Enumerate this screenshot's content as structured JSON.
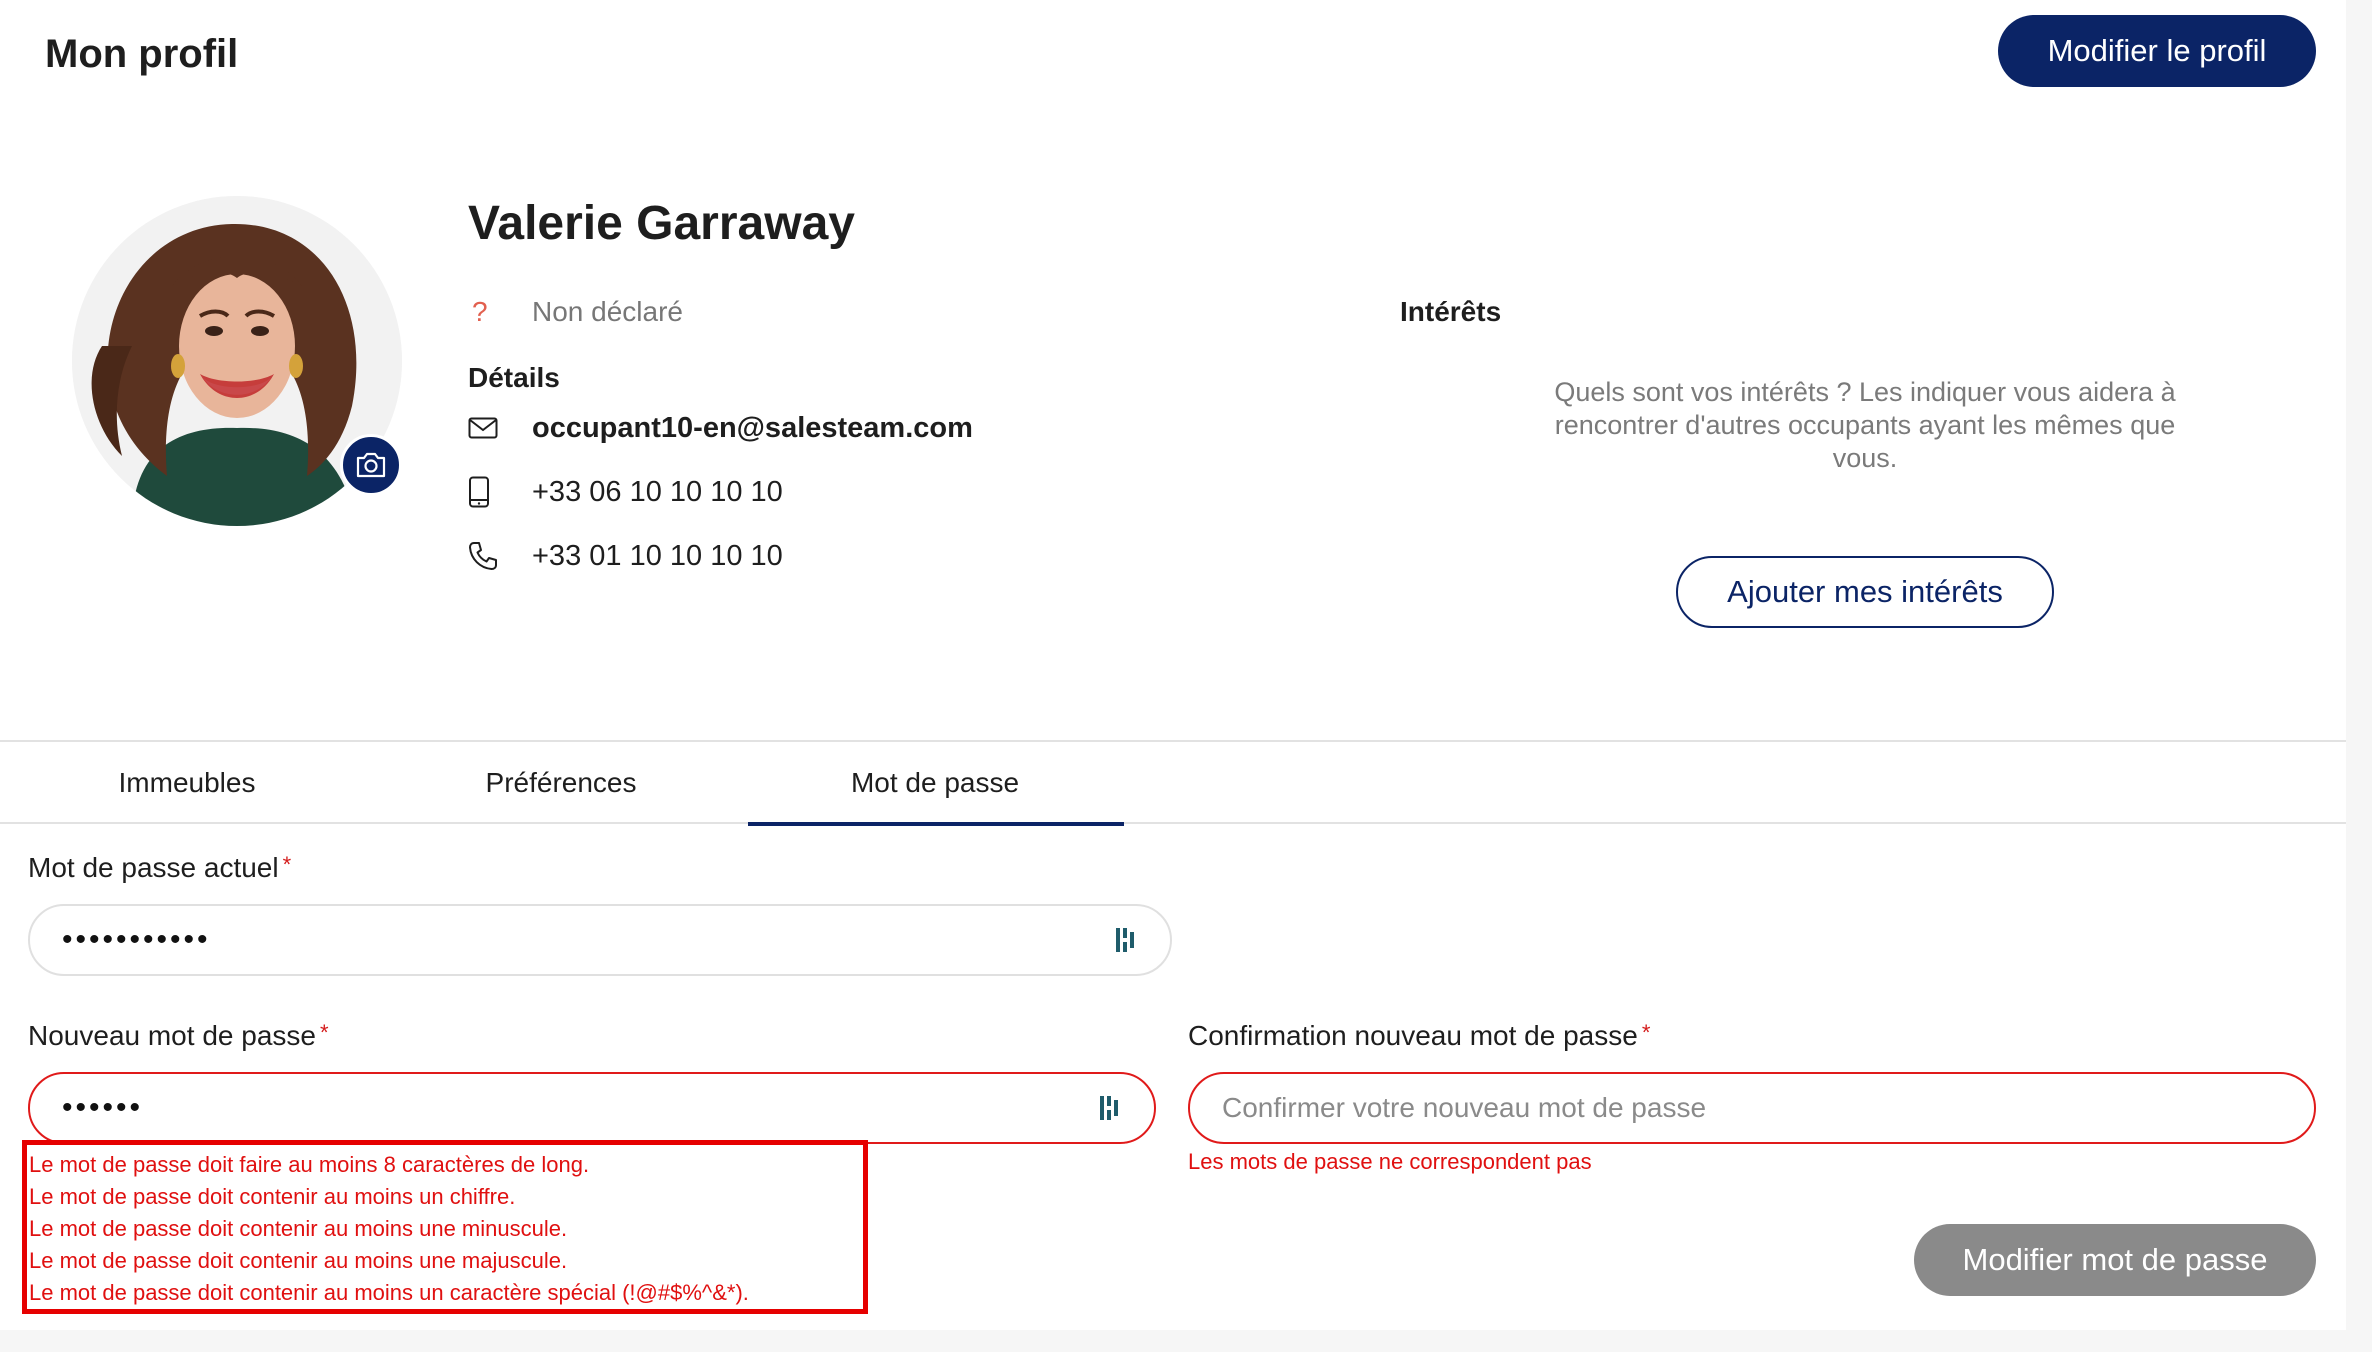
{
  "header": {
    "title": "Mon profil",
    "edit_button": "Modifier le profil"
  },
  "profile": {
    "name": "Valerie Garraway",
    "gender_icon": "?",
    "gender": "Non déclaré",
    "details_title": "Détails",
    "email": "occupant10-en@salesteam.com",
    "mobile": "+33 06 10 10 10 10",
    "phone": "+33 01 10 10 10 10"
  },
  "interests": {
    "title": "Intérêts",
    "prompt": "Quels sont vos intérêts ? Les indiquer vous aidera à rencontrer d'autres occupants ayant les mêmes que vous.",
    "add_button": "Ajouter mes intérêts"
  },
  "tabs": [
    {
      "label": "Immeubles",
      "active": false
    },
    {
      "label": "Préférences",
      "active": false
    },
    {
      "label": "Mot de passe",
      "active": true
    }
  ],
  "password_form": {
    "current": {
      "label": "Mot de passe actuel",
      "required_mark": "*",
      "value": "•••••••••••"
    },
    "new": {
      "label": "Nouveau mot de passe",
      "required_mark": "*",
      "value": "••••••",
      "errors": [
        "Le mot de passe doit faire au moins 8 caractères de long.",
        "Le mot de passe doit contenir au moins un chiffre.",
        "Le mot de passe doit contenir au moins une minuscule.",
        "Le mot de passe doit contenir au moins une majuscule.",
        "Le mot de passe doit contenir au moins un caractère spécial (!@#$%^&*)."
      ]
    },
    "confirm": {
      "label": "Confirmation nouveau mot de passe",
      "required_mark": "*",
      "placeholder": "Confirmer votre nouveau mot de passe",
      "error": "Les mots de passe ne correspondent pas"
    },
    "submit_button": "Modifier mot de passe"
  },
  "colors": {
    "primary": "#0b2466",
    "error": "#e01010",
    "disabled_button": "#8a8a8a"
  },
  "icons": {
    "camera": "camera-icon",
    "email": "envelope-icon",
    "mobile": "mobile-phone-icon",
    "phone": "phone-handset-icon",
    "password_manager": "password-manager-icon"
  }
}
